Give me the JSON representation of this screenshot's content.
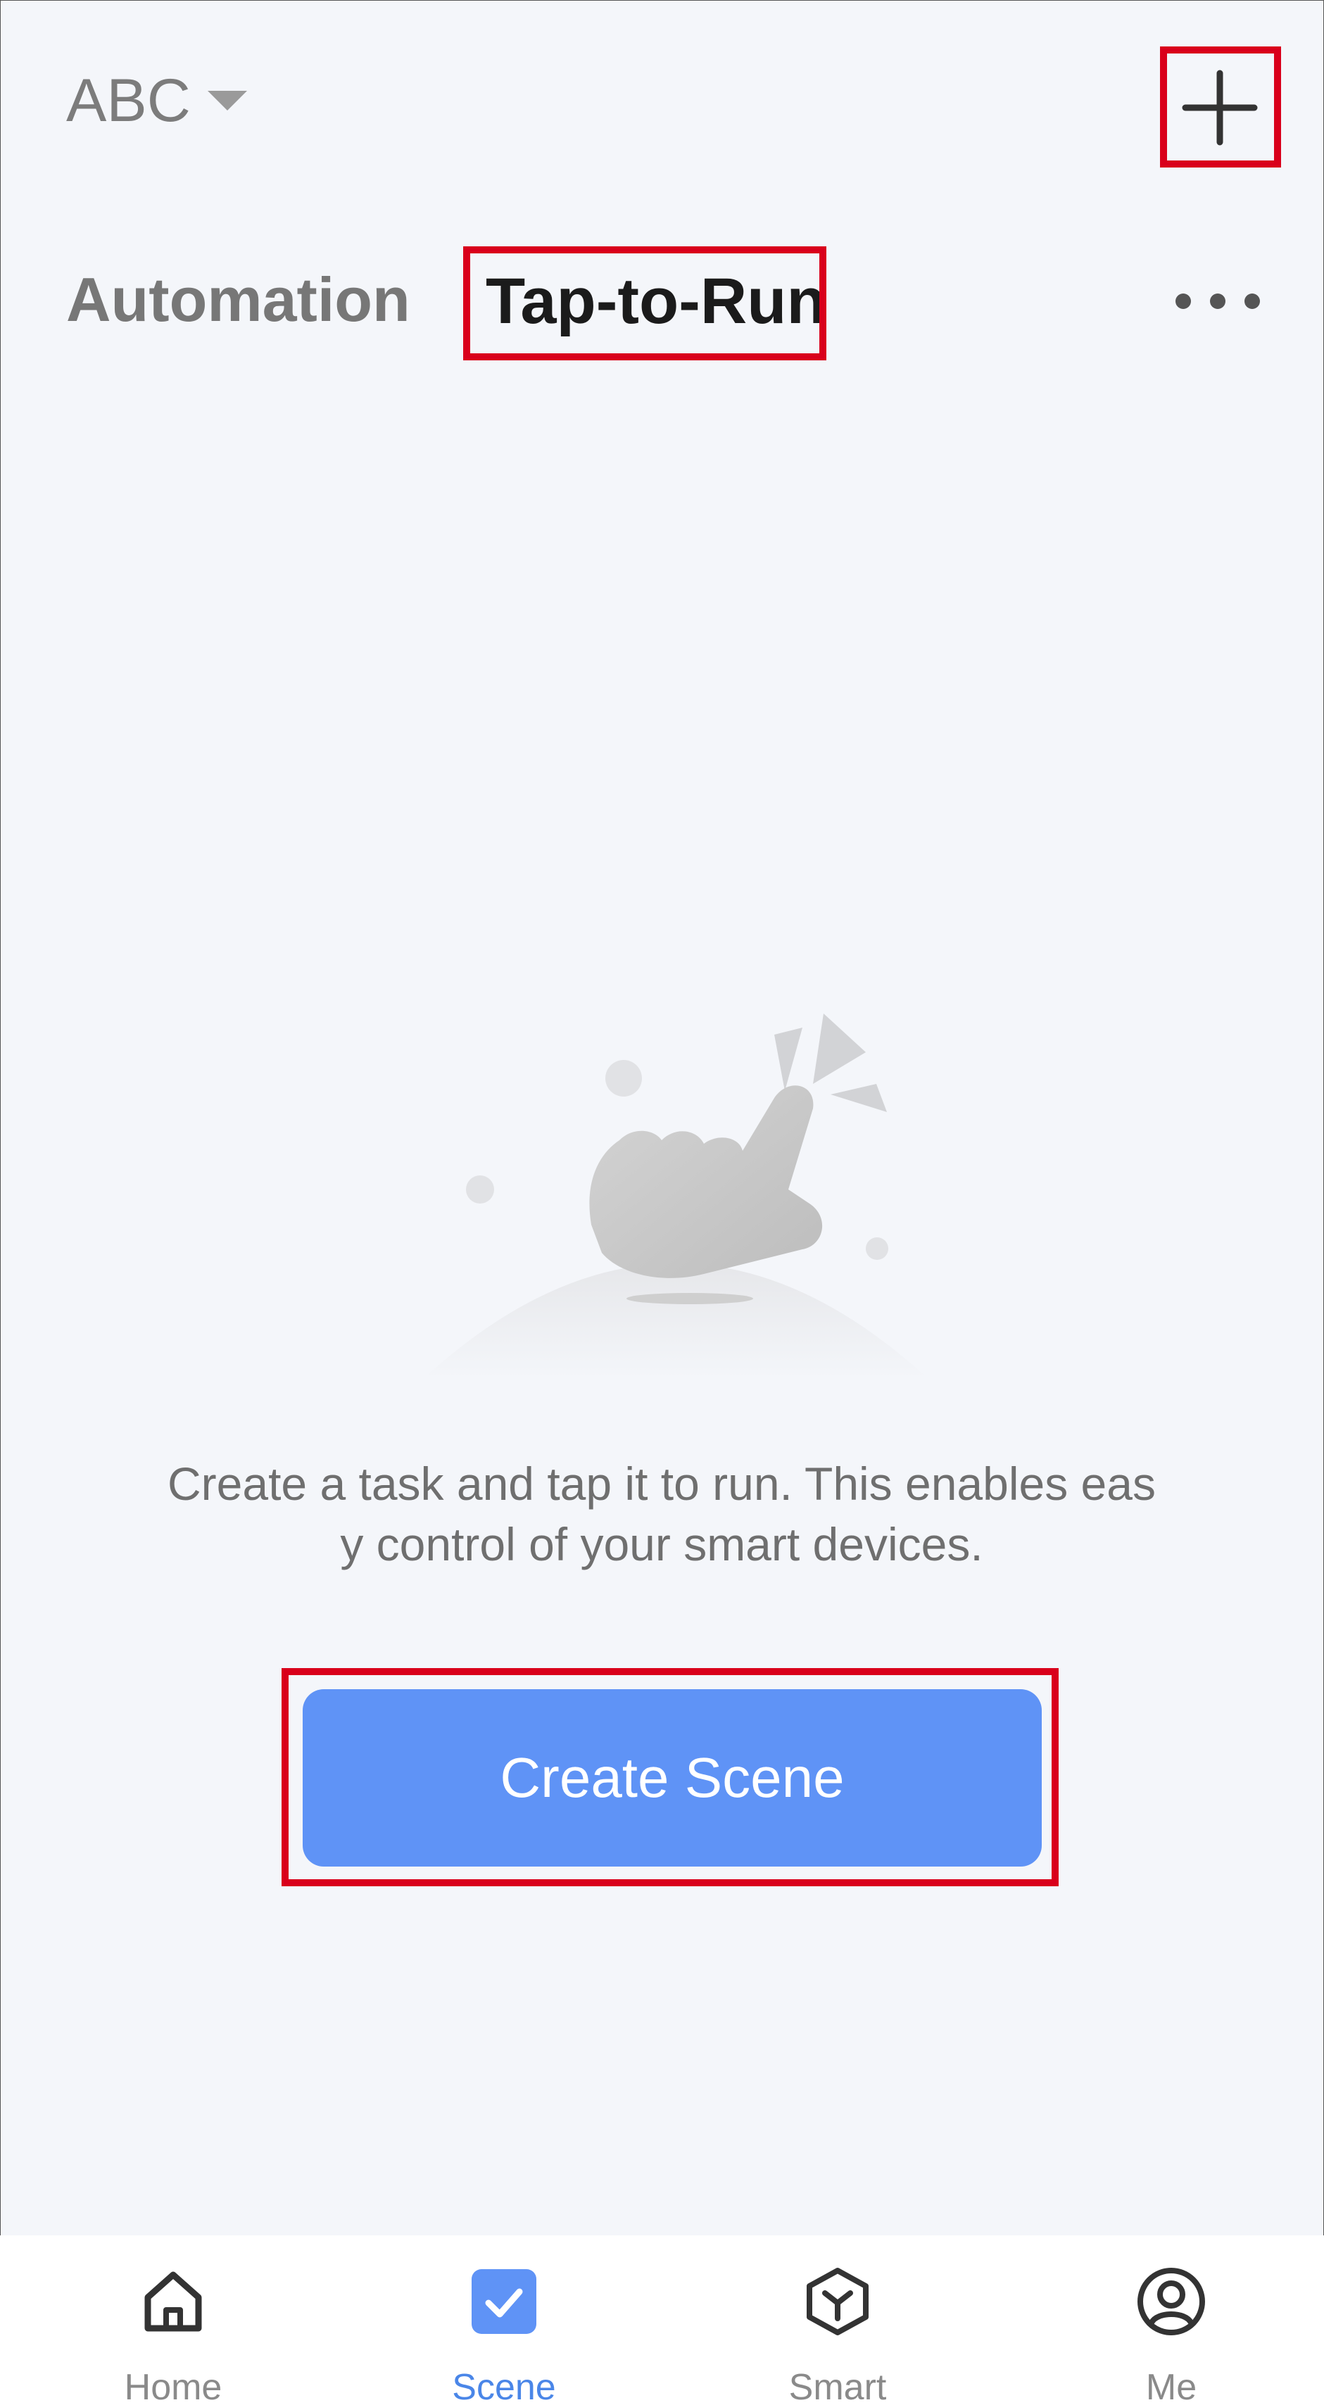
{
  "header": {
    "home_name": "ABC",
    "add_icon": "plus-icon"
  },
  "tabs": [
    {
      "label": "Automation",
      "active": false
    },
    {
      "label": "Tap-to-Run",
      "active": true
    }
  ],
  "empty_state": {
    "description_line1": "Create a task and tap it to run. This enables eas",
    "description_line2": "y control of your smart devices.",
    "button_label": "Create Scene"
  },
  "bottom_nav": [
    {
      "label": "Home",
      "icon": "home-icon",
      "active": false
    },
    {
      "label": "Scene",
      "icon": "scene-check-icon",
      "active": true
    },
    {
      "label": "Smart",
      "icon": "smart-cube-icon",
      "active": false
    },
    {
      "label": "Me",
      "icon": "user-icon",
      "active": false
    }
  ],
  "colors": {
    "accent": "#5f93f6",
    "active_nav": "#4a86e8",
    "highlight_box": "#d9001b",
    "background": "#f4f6fa"
  }
}
